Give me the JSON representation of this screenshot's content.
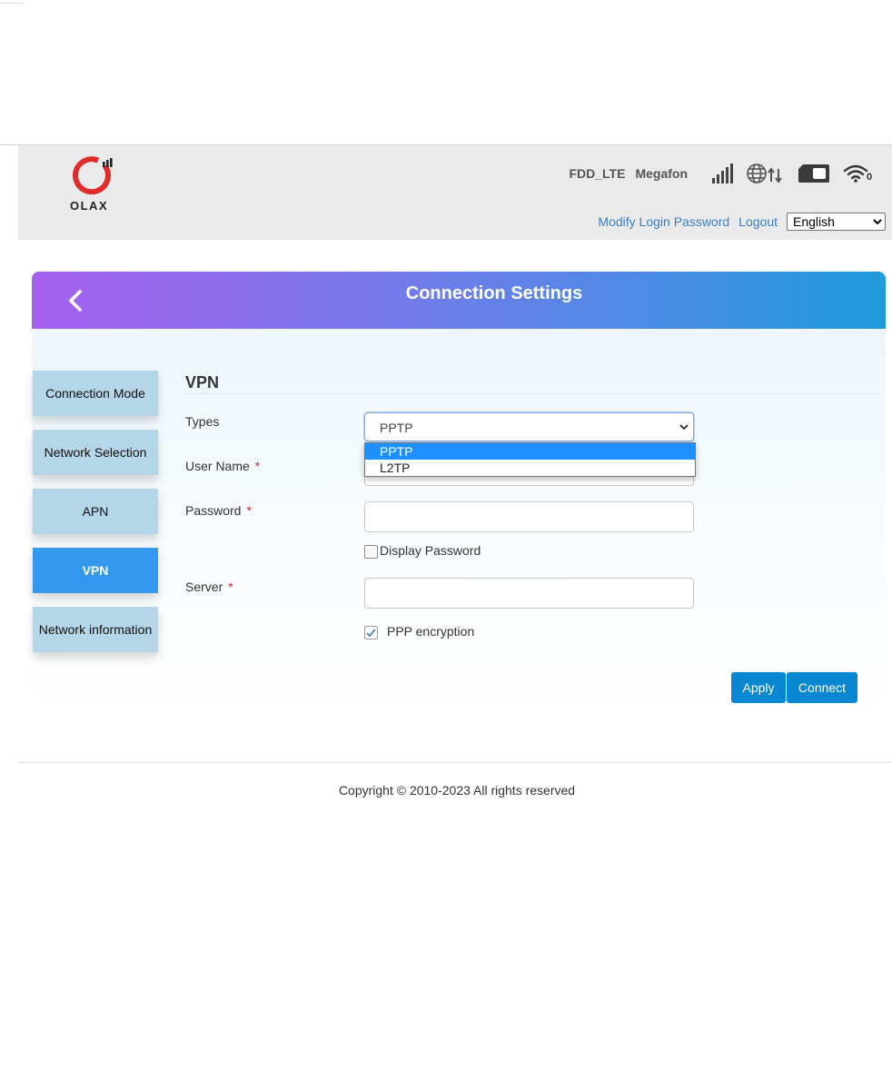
{
  "header": {
    "logo_text": "OLAX",
    "network_type": "FDD_LTE",
    "operator": "Megafon",
    "wifi_clients": "0",
    "links": {
      "modify_password": "Modify Login Password",
      "logout": "Logout"
    },
    "language": {
      "selected": "English",
      "options": [
        "English"
      ]
    },
    "icons": [
      "signal-strength-icon",
      "globe-icon",
      "data-transfer-icon",
      "battery-icon",
      "wifi-icon"
    ]
  },
  "banner": {
    "title": "Connection Settings",
    "back_icon": "chevron-left-icon"
  },
  "sidebar": {
    "items": [
      {
        "label": "Connection Mode",
        "active": false
      },
      {
        "label": "Network Selection",
        "active": false
      },
      {
        "label": "APN",
        "active": false
      },
      {
        "label": "VPN",
        "active": true
      },
      {
        "label": "Network information",
        "active": false
      }
    ]
  },
  "form": {
    "section_title": "VPN",
    "types": {
      "label": "Types",
      "value": "PPTP",
      "options": [
        "PPTP",
        "L2TP"
      ]
    },
    "username": {
      "label": "User Name",
      "required_mark": "*",
      "value": ""
    },
    "password": {
      "label": "Password",
      "required_mark": "*",
      "value": ""
    },
    "display_password": {
      "label": "Display Password",
      "checked": false
    },
    "server": {
      "label": "Server",
      "required_mark": "*",
      "value": ""
    },
    "ppp_encryption": {
      "label": "PPP encryption",
      "checked": true
    },
    "buttons": {
      "apply": "Apply",
      "connect": "Connect"
    }
  },
  "footer": {
    "copyright": "Copyright © 2010-2023 All rights reserved"
  },
  "colors": {
    "banner_gradient_start": "#a660f0",
    "banner_gradient_end": "#1f9bdc",
    "active_tab": "#3598ef",
    "inactive_tab": "#b5d5e8",
    "primary_button": "#0a87d2",
    "link": "#3a7fc4",
    "logo_red": "#e02b2b",
    "required": "#c1272d"
  }
}
